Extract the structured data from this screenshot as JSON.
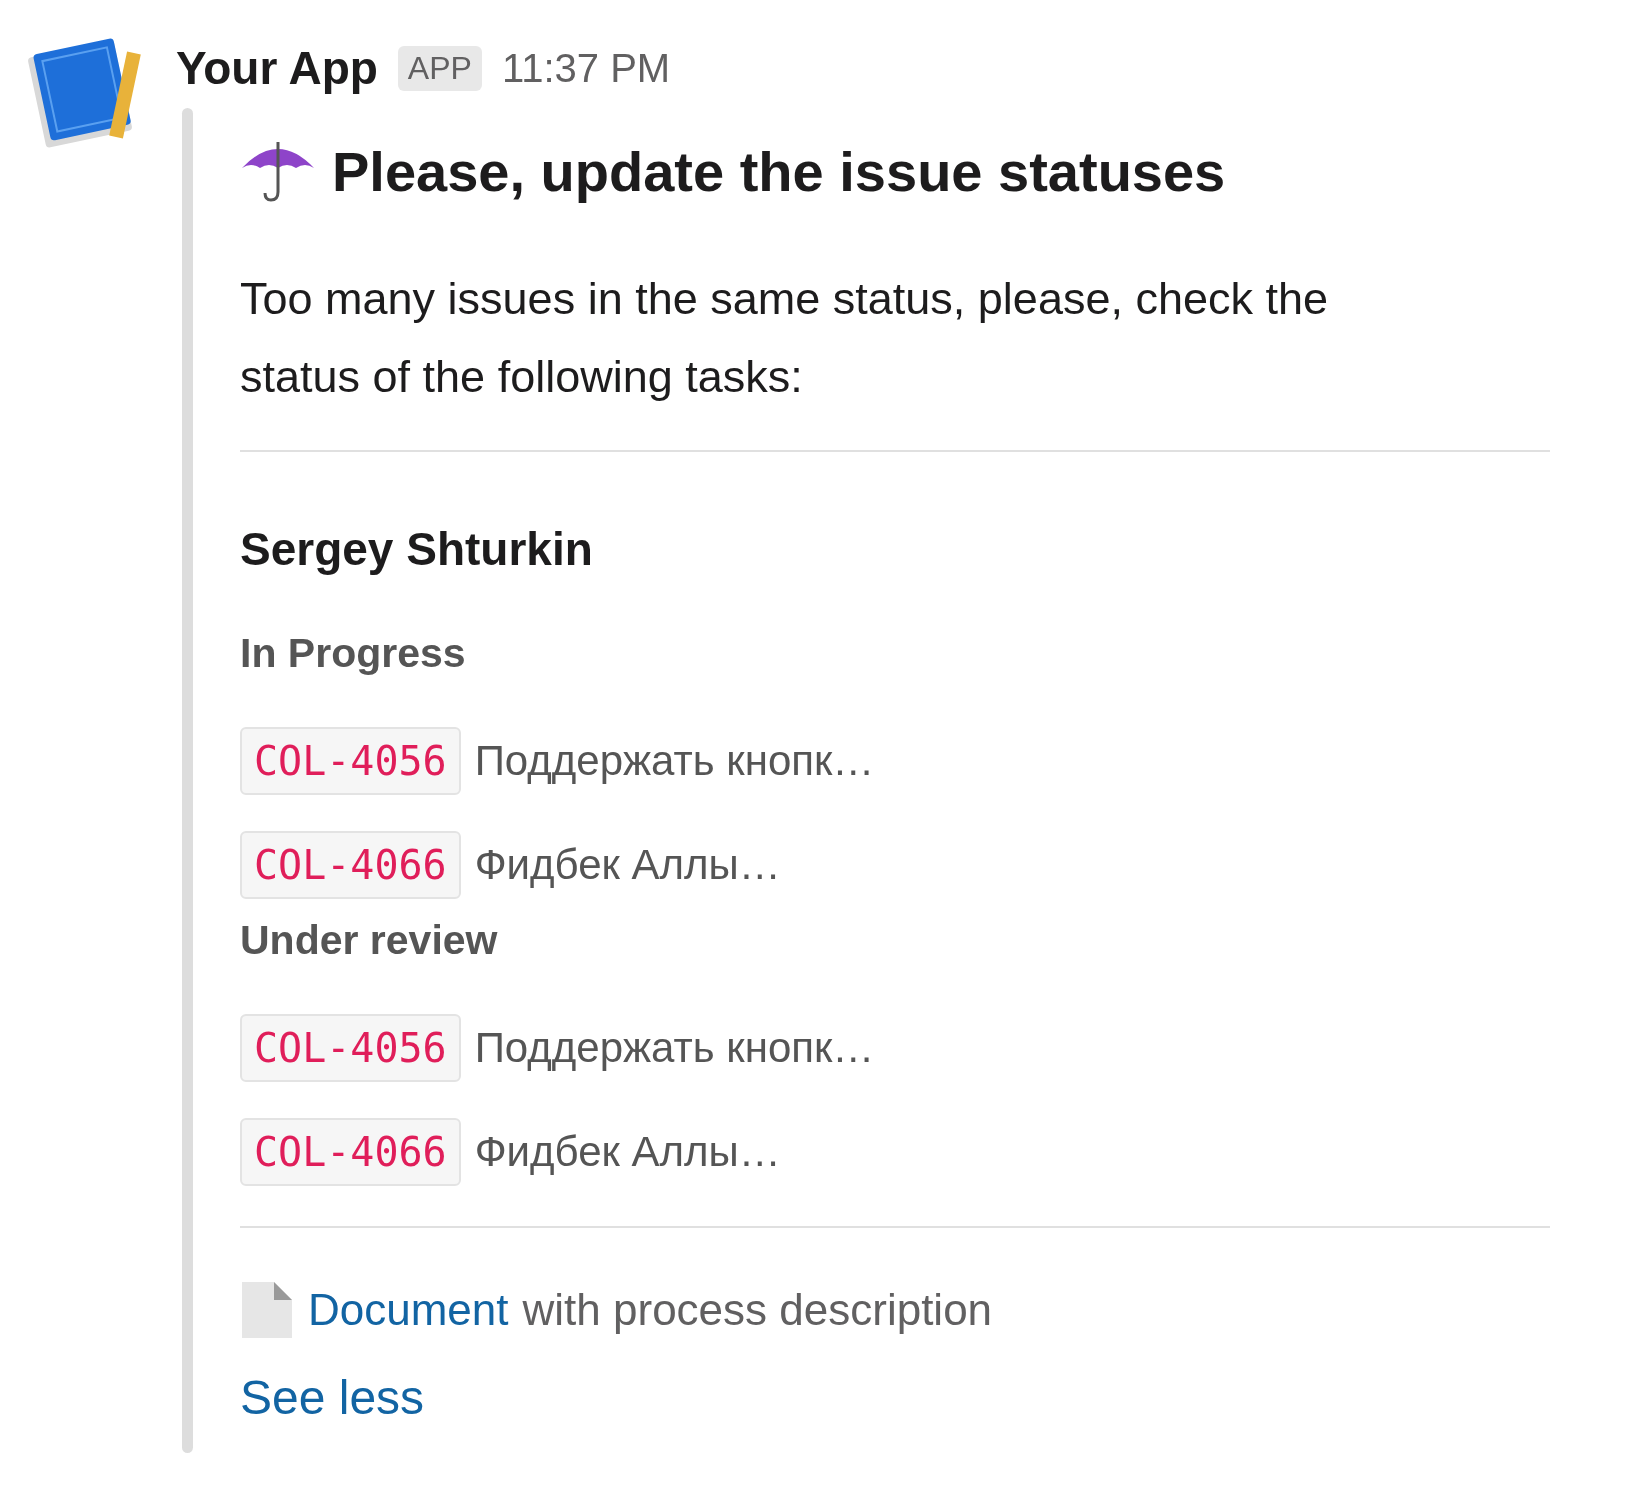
{
  "message": {
    "sender": "Your App",
    "badge": "APP",
    "time": "11:37 PM",
    "title": "Please, update the issue statuses",
    "body": "Too many issues in the same status, please, check the status of the following tasks:",
    "assignee": "Sergey Shturkin",
    "groups": [
      {
        "status": "In Progress",
        "issues": [
          {
            "key": "COL-4056",
            "summary": "Поддержать кнопк…"
          },
          {
            "key": "COL-4066",
            "summary": "Фидбек Аллы…"
          }
        ]
      },
      {
        "status": "Under review",
        "issues": [
          {
            "key": "COL-4056",
            "summary": "Поддержать кнопк…"
          },
          {
            "key": "COL-4066",
            "summary": "Фидбек Аллы…"
          }
        ]
      }
    ],
    "link": {
      "label": "Document",
      "rest": "with process description"
    },
    "toggle": "See less"
  }
}
